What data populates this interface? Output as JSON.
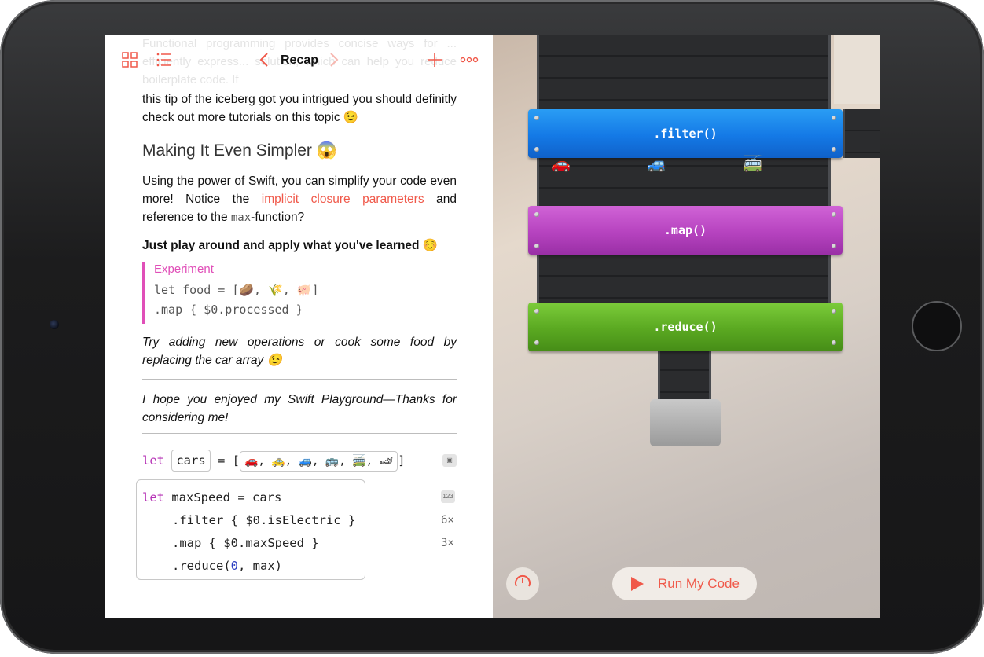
{
  "nav": {
    "title": "Recap",
    "grid_icon": "grid-icon",
    "list_icon": "list-icon",
    "back_icon": "chevron-left-icon",
    "forward_icon": "chevron-right-icon",
    "add_icon": "plus-icon",
    "more_icon": "ellipsis-icon"
  },
  "doc": {
    "faded_text": "Functional programming provides concise ways for ... efficiently express... solution, which can help you reduce boilerplate code. If",
    "intro_rest": "this tip of the iceberg got you intrigued you should definitly check out more tutorials on this topic 😉",
    "heading": "Making It Even Simpler 😱",
    "para_a": "Using the power of Swift, you can simplify your code even more! Notice the ",
    "para_link": "implicit closure parameters",
    "para_b": " and reference to the ",
    "para_code": "max",
    "para_c": "-function?",
    "bold_line": "Just play around and apply what you've learned ☺️",
    "experiment_label": "Experiment",
    "experiment_code_1": "let food = [🥔, 🌾, 🐖]",
    "experiment_code_2": " .map { $0.processed }",
    "italic_1": "Try adding new operations or cook some food by replacing the car array 😉",
    "italic_2": "I hope you enjoyed my Swift Playground—Thanks for considering me!"
  },
  "code": {
    "let_kw": "let",
    "cars_token": "cars",
    "equals_bracket": "= [",
    "cars_array": "🚗, 🚕, 🚙, 🚌, 🚎, 🏎",
    "close_bracket": "]",
    "line1_kw": "let",
    "line1_rest": " maxSpeed = cars",
    "line2": ".filter { $0.isElectric }",
    "line3": ".map { $0.maxSpeed }",
    "line4_a": ".reduce(",
    "line4_num": "0",
    "line4_b": ", max)",
    "badge_123": "123",
    "filter_result": "6×",
    "map_result": "3×"
  },
  "live": {
    "filter_label": ".filter()",
    "map_label": ".map()",
    "reduce_label": ".reduce()",
    "run_label": "Run My Code",
    "speed_icon": "speedometer-icon",
    "colors": {
      "accent": "#f0594a",
      "filter": "#1479e6",
      "map": "#b643bf",
      "reduce": "#5aa821"
    }
  }
}
